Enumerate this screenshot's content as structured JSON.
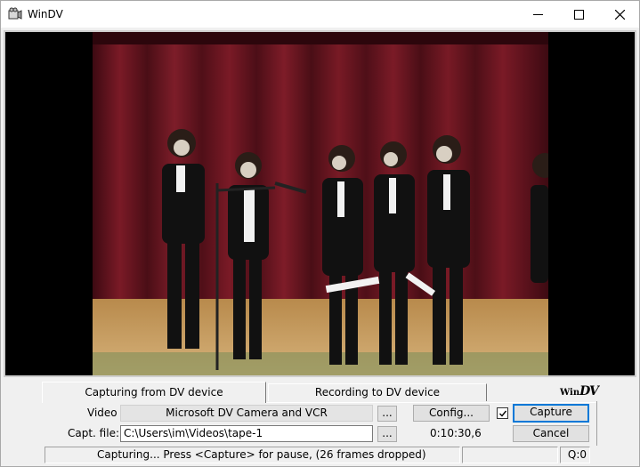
{
  "window": {
    "title": "WinDV"
  },
  "tabs": [
    {
      "label": "Capturing from DV device",
      "active": true
    },
    {
      "label": "Recording to DV device",
      "active": false
    }
  ],
  "logo": {
    "prefix": "Win",
    "suffix": "DV"
  },
  "video_row": {
    "label": "Video",
    "device": "Microsoft DV Camera and VCR",
    "browse_label": "...",
    "config_label": "Config..."
  },
  "file_row": {
    "label": "Capt. file:",
    "value": "C:\\Users\\im\\Videos\\tape-1",
    "browse_label": "...",
    "timecode": "0:10:30,6"
  },
  "actions": {
    "capture_checked": true,
    "capture_label": "Capture",
    "cancel_label": "Cancel"
  },
  "status": {
    "message": "Capturing...  Press <Capture> for pause, (26 frames dropped)",
    "middle": "",
    "queue": "Q:0"
  },
  "colors": {
    "accent": "#0078d7",
    "curtain": "#6b1620",
    "floor": "#c8a268"
  },
  "icons": [
    "camera-icon",
    "minimize-icon",
    "maximize-icon",
    "close-icon",
    "checkmark-icon"
  ]
}
